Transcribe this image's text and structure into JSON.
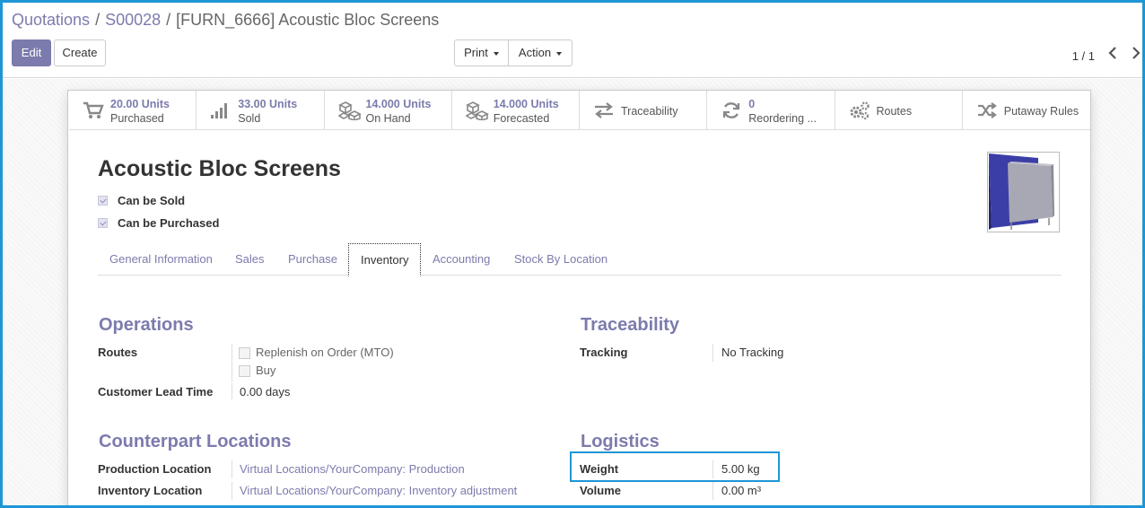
{
  "breadcrumb": {
    "items": [
      "Quotations",
      "S00028"
    ],
    "separator": "/",
    "current": "[FURN_6666] Acoustic Bloc Screens"
  },
  "toolbar": {
    "edit_label": "Edit",
    "create_label": "Create",
    "print_label": "Print",
    "action_label": "Action"
  },
  "pager": {
    "value": "1 / 1",
    "prev_icon": "chevron-left-icon",
    "next_icon": "chevron-right-icon"
  },
  "smart_buttons": [
    {
      "value": "20.00 Units",
      "label": "Purchased",
      "icon": "cart-icon"
    },
    {
      "value": "33.00 Units",
      "label": "Sold",
      "icon": "bar-chart-icon"
    },
    {
      "value": "14.000 Units",
      "label": "On Hand",
      "icon": "cubes-icon"
    },
    {
      "value": "14.000 Units",
      "label": "Forecasted",
      "icon": "cubes-icon"
    },
    {
      "value": "",
      "label": "Traceability",
      "icon": "exchange-icon"
    },
    {
      "value": "0",
      "label": "Reordering ...",
      "icon": "refresh-icon"
    },
    {
      "value": "",
      "label": "Routes",
      "icon": "cogs-icon"
    },
    {
      "value": "",
      "label": "Putaway Rules",
      "icon": "random-icon"
    }
  ],
  "product": {
    "name": "Acoustic Bloc Screens",
    "can_be_sold": "Can be Sold",
    "can_be_purchased": "Can be Purchased"
  },
  "tabs": [
    "General Information",
    "Sales",
    "Purchase",
    "Inventory",
    "Accounting",
    "Stock By Location"
  ],
  "active_tab": "Inventory",
  "operations": {
    "title": "Operations",
    "routes_label": "Routes",
    "route_options": [
      "Replenish on Order (MTO)",
      "Buy"
    ],
    "lead_time_label": "Customer Lead Time",
    "lead_time_value": "0.00 days"
  },
  "traceability": {
    "title": "Traceability",
    "tracking_label": "Tracking",
    "tracking_value": "No Tracking"
  },
  "counterpart": {
    "title": "Counterpart Locations",
    "production_label": "Production Location",
    "production_value": "Virtual Locations/YourCompany: Production",
    "inventory_label": "Inventory Location",
    "inventory_value": "Virtual Locations/YourCompany: Inventory adjustment"
  },
  "logistics": {
    "title": "Logistics",
    "weight_label": "Weight",
    "weight_value": "5.00 kg",
    "volume_label": "Volume",
    "volume_value": "0.00 m³"
  },
  "colors": {
    "accent": "#7c7bad",
    "highlight": "#1e96d6"
  }
}
